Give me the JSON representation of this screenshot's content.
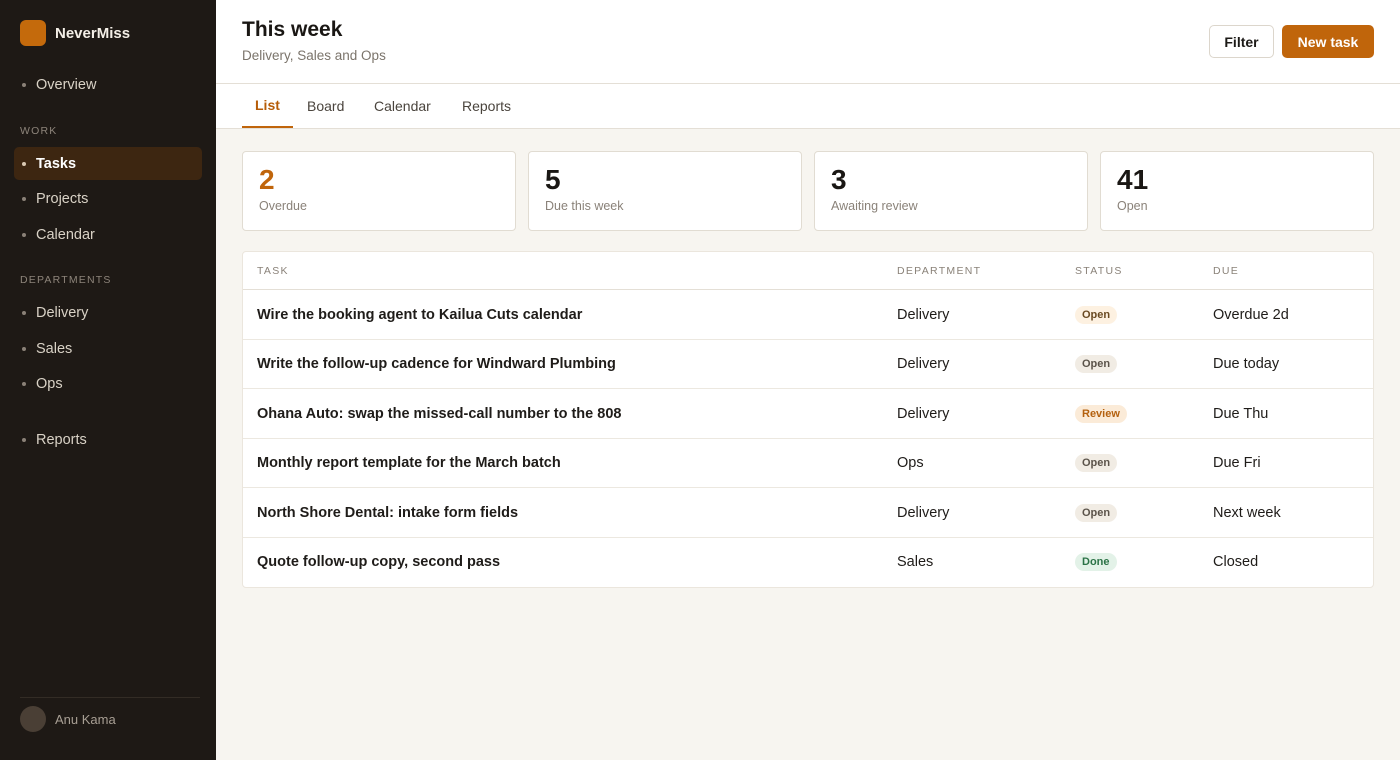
{
  "app": {
    "name": "NeverMiss"
  },
  "sidebar": {
    "overview": "Overview",
    "work_label": "WORK",
    "work_items": [
      "Tasks",
      "Projects",
      "Calendar"
    ],
    "departments_label": "DEPARTMENTS",
    "department_items": [
      "Delivery",
      "Sales",
      "Ops"
    ],
    "reports": "Reports",
    "active_item": "Tasks",
    "user_name": "Anu Kama"
  },
  "header": {
    "title": "This week",
    "subtitle": "Delivery, Sales and Ops",
    "filter_label": "Filter",
    "new_task_label": "New task"
  },
  "tabs": [
    "List",
    "Board",
    "Calendar",
    "Reports"
  ],
  "active_tab": "List",
  "stats": [
    {
      "value": "2",
      "label": "Overdue"
    },
    {
      "value": "5",
      "label": "Due this week"
    },
    {
      "value": "3",
      "label": "Awaiting review"
    },
    {
      "value": "41",
      "label": "Open"
    }
  ],
  "table": {
    "columns": [
      "TASK",
      "DEPARTMENT",
      "STATUS",
      "DUE"
    ],
    "rows": [
      {
        "task": "Wire the booking agent to Kailua Cuts calendar",
        "department": "Delivery",
        "status": "Open",
        "due": "Overdue 2d"
      },
      {
        "task": "Write the follow-up cadence for Windward Plumbing",
        "department": "Delivery",
        "status": "Open",
        "due": "Due today"
      },
      {
        "task": "Ohana Auto: swap the missed-call number to the 808",
        "department": "Delivery",
        "status": "Review",
        "due": "Due Thu"
      },
      {
        "task": "Monthly report template for the March batch",
        "department": "Ops",
        "status": "Open",
        "due": "Due Fri"
      },
      {
        "task": "North Shore Dental: intake form fields",
        "department": "Delivery",
        "status": "Open",
        "due": "Next week"
      },
      {
        "task": "Quote follow-up copy, second pass",
        "department": "Sales",
        "status": "Done",
        "due": "Closed"
      }
    ]
  },
  "colors": {
    "accent": "#c0650b",
    "sidebar_bg": "#1e1915",
    "page_bg": "#f7f5f0"
  }
}
